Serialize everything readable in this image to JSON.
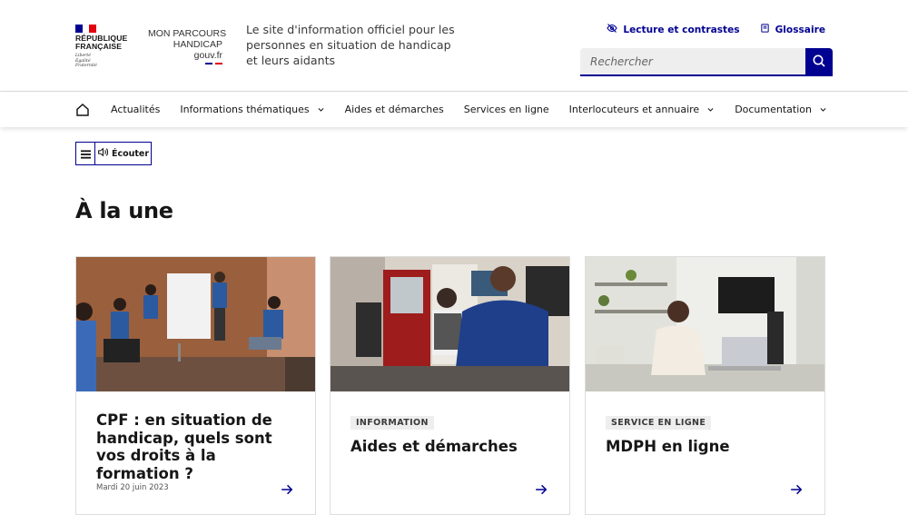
{
  "header": {
    "republique": "RÉPUBLIQUE FRANÇAISE",
    "motto": [
      "Liberté",
      "Égalité",
      "Fraternité"
    ],
    "brand_lines": [
      "MON PARCOURS",
      "HANDICAP",
      "gouv.fr"
    ],
    "tagline": "Le site d'information officiel pour les personnes en situation de handicap et leurs aidants",
    "tools": [
      {
        "label": "Lecture et contrastes",
        "icon": "eye-slash-icon"
      },
      {
        "label": "Glossaire",
        "icon": "book-icon"
      }
    ],
    "search": {
      "placeholder": "Rechercher"
    }
  },
  "nav": {
    "items": [
      {
        "label": "Actualités",
        "dropdown": false
      },
      {
        "label": "Informations thématiques",
        "dropdown": true
      },
      {
        "label": "Aides et démarches",
        "dropdown": false
      },
      {
        "label": "Services en ligne",
        "dropdown": false
      },
      {
        "label": "Interlocuteurs et annuaire",
        "dropdown": true
      },
      {
        "label": "Documentation",
        "dropdown": true
      }
    ]
  },
  "listen": {
    "label": "Écouter"
  },
  "main": {
    "heading": "À la une",
    "cards": [
      {
        "badge": "",
        "title": "CPF : en situation de handicap, quels sont vos droits à la formation ?",
        "date": "Mardi 20 juin 2023"
      },
      {
        "badge": "INFORMATION",
        "title": "Aides et démarches",
        "date": ""
      },
      {
        "badge": "SERVICE EN LIGNE",
        "title": "MDPH en ligne",
        "date": ""
      }
    ]
  },
  "colors": {
    "primary": "#000091",
    "flag_blue": "#000091",
    "flag_red": "#e1000f",
    "badge_bg": "#eeeeee"
  }
}
